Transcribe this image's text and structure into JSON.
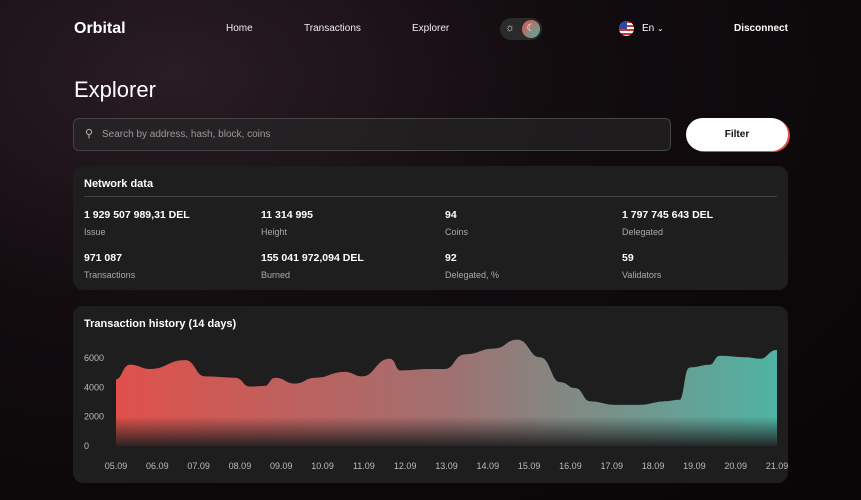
{
  "nav": {
    "logo": "Orbital",
    "links": [
      "Home",
      "Transactions",
      "Explorer"
    ],
    "lang": "En",
    "disconnect": "Disconnect"
  },
  "page": {
    "title": "Explorer",
    "search_placeholder": "Search by address, hash, block, coins",
    "filter": "Filter"
  },
  "network": {
    "title": "Network data",
    "stats": [
      {
        "value": "1 929 507 989,31 DEL",
        "label": "Issue"
      },
      {
        "value": "11 314 995",
        "label": "Height"
      },
      {
        "value": "94",
        "label": "Coins"
      },
      {
        "value": "1 797 745 643 DEL",
        "label": "Delegated"
      },
      {
        "value": "971 087",
        "label": "Transactions"
      },
      {
        "value": "155 041 972,094 DEL",
        "label": "Burned"
      },
      {
        "value": "92",
        "label": "Delegated, %"
      },
      {
        "value": "59",
        "label": "Validators"
      }
    ]
  },
  "chart_data": {
    "type": "area",
    "title": "Transaction history (14 days)",
    "categories": [
      "05.09",
      "06.09",
      "07.09",
      "08.09",
      "09.09",
      "10.09",
      "11.09",
      "12.09",
      "13.09",
      "14.09",
      "15.09",
      "16.09",
      "17.09",
      "18.09",
      "19.09",
      "20.09",
      "21.09"
    ],
    "yticks": [
      "0",
      "2000",
      "4000",
      "6000"
    ],
    "ylim": [
      0,
      7500
    ],
    "points": [
      [
        0,
        4500
      ],
      [
        0.34,
        5500
      ],
      [
        0.82,
        5200
      ],
      [
        1.67,
        5800
      ],
      [
        2.15,
        4700
      ],
      [
        2.88,
        4600
      ],
      [
        3.24,
        4000
      ],
      [
        3.61,
        4050
      ],
      [
        3.85,
        4600
      ],
      [
        4.33,
        4200
      ],
      [
        4.82,
        4600
      ],
      [
        5.54,
        5000
      ],
      [
        5.95,
        4700
      ],
      [
        6.63,
        5900
      ],
      [
        6.87,
        5100
      ],
      [
        7.6,
        5200
      ],
      [
        7.96,
        5200
      ],
      [
        8.45,
        6200
      ],
      [
        9.17,
        6600
      ],
      [
        9.71,
        7200
      ],
      [
        10.26,
        6000
      ],
      [
        10.75,
        4300
      ],
      [
        11.11,
        3900
      ],
      [
        11.47,
        3000
      ],
      [
        12.08,
        2750
      ],
      [
        12.68,
        2750
      ],
      [
        13.29,
        3000
      ],
      [
        13.65,
        3100
      ],
      [
        13.89,
        5300
      ],
      [
        14.38,
        5500
      ],
      [
        14.62,
        6100
      ],
      [
        15.23,
        6000
      ],
      [
        15.59,
        5900
      ],
      [
        16,
        6500
      ]
    ],
    "colors": {
      "start": "#e0504a",
      "end": "#4fb3a3"
    }
  }
}
